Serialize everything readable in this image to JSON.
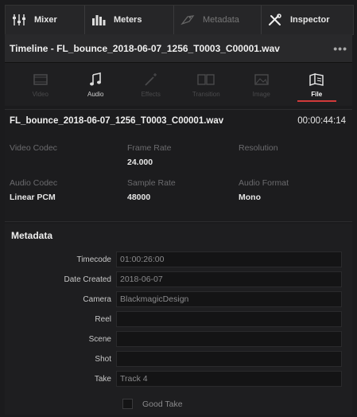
{
  "topbar": {
    "mixer": "Mixer",
    "meters": "Meters",
    "metadata": "Metadata",
    "inspector": "Inspector"
  },
  "title": "Timeline - FL_bounce_2018-06-07_1256_T0003_C00001.wav",
  "more": "•••",
  "tabs": {
    "video": "Video",
    "audio": "Audio",
    "effects": "Effects",
    "transition": "Transition",
    "image": "Image",
    "file": "File"
  },
  "file": {
    "name": "FL_bounce_2018-06-07_1256_T0003_C00001.wav",
    "duration": "00:00:44:14",
    "video_codec_label": "Video Codec",
    "frame_rate_label": "Frame Rate",
    "frame_rate": "24.000",
    "resolution_label": "Resolution",
    "audio_codec_label": "Audio Codec",
    "audio_codec": "Linear PCM",
    "sample_rate_label": "Sample Rate",
    "sample_rate": "48000",
    "audio_format_label": "Audio Format",
    "audio_format": "Mono"
  },
  "metadata": {
    "title": "Metadata",
    "timecode_label": "Timecode",
    "timecode": "01:00:26:00",
    "date_label": "Date Created",
    "date": "2018-06-07",
    "camera_label": "Camera",
    "camera": "BlackmagicDesign",
    "reel_label": "Reel",
    "reel": "",
    "scene_label": "Scene",
    "scene": "",
    "shot_label": "Shot",
    "shot": "",
    "take_label": "Take",
    "take": "Track 4",
    "good_take_label": "Good Take"
  },
  "colors": {
    "accent": "#d23a3a"
  }
}
